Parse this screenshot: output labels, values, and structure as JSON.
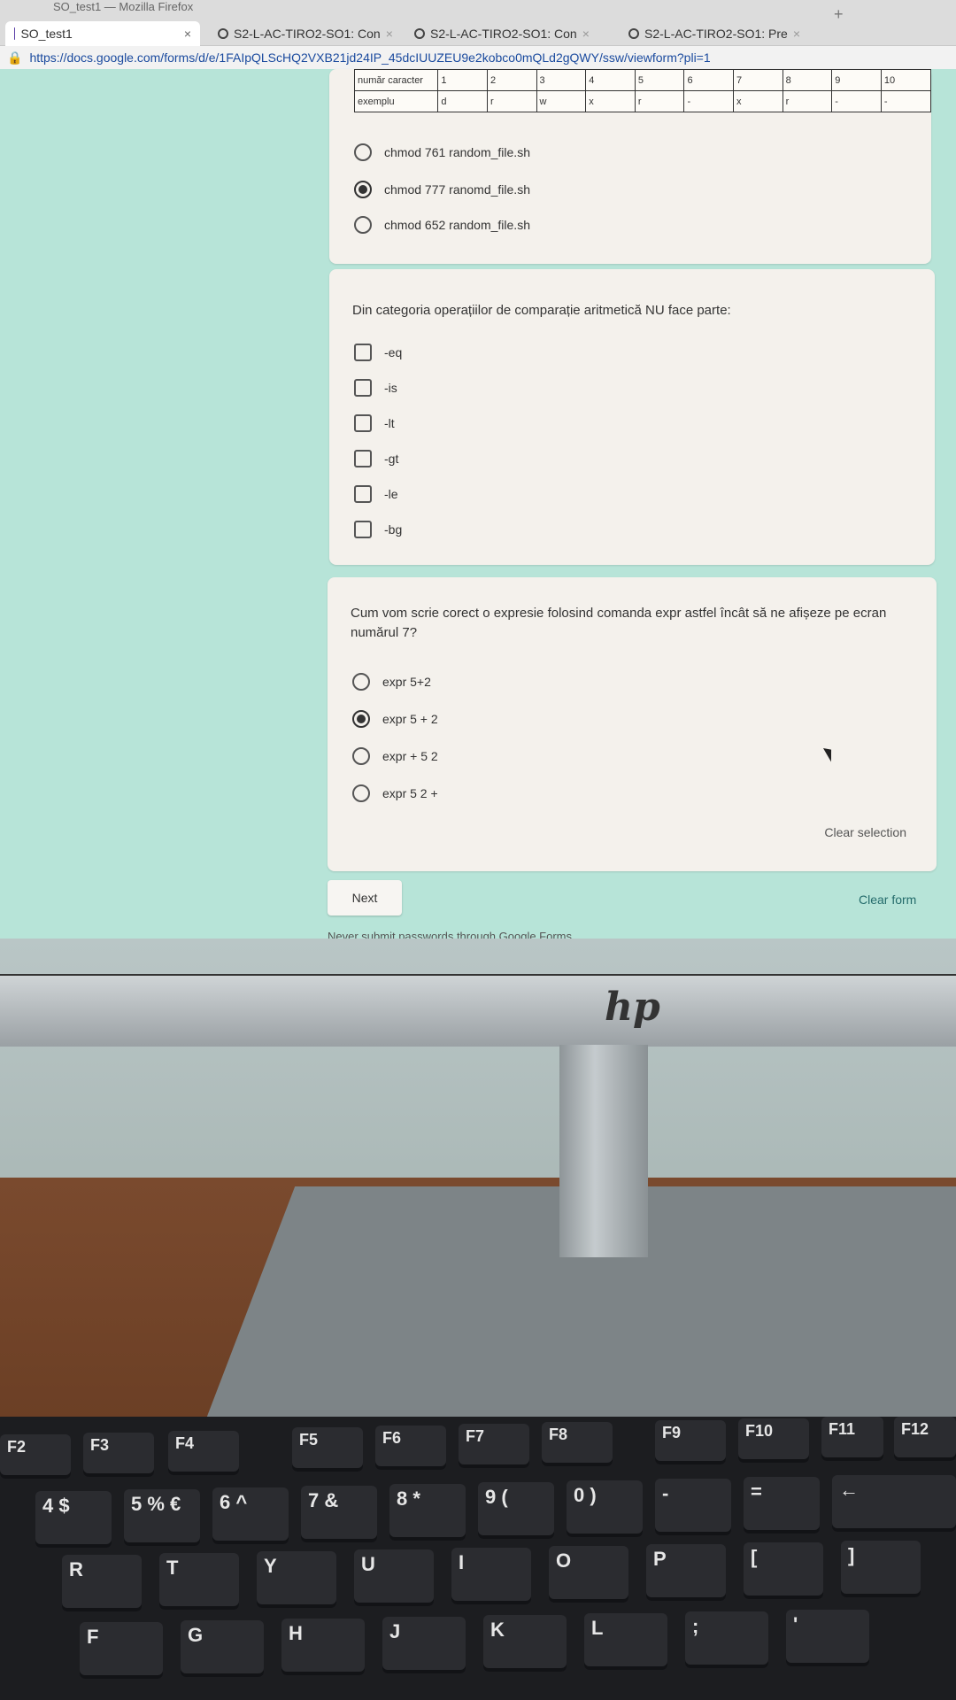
{
  "browser": {
    "window_title": "SO_test1 — Mozilla Firefox",
    "tabs": [
      {
        "label": "SO_test1",
        "active": true
      },
      {
        "label": "S2-L-AC-TIRO2-SO1: Con",
        "active": false
      },
      {
        "label": "S2-L-AC-TIRO2-SO1: Con",
        "active": false
      },
      {
        "label": "S2-L-AC-TIRO2-SO1: Pre",
        "active": false
      }
    ],
    "url": "https://docs.google.com/forms/d/e/1FAIpQLScHQ2VXB21jd24IP_45dcIUUZEU9e2kobco0mQLd2gQWY/ssw/viewform?pli=1"
  },
  "reference_table": {
    "row1": [
      "număr caracter",
      "1",
      "2",
      "3",
      "4",
      "5",
      "6",
      "7",
      "8",
      "9",
      "10"
    ],
    "row2": [
      "exemplu",
      "d",
      "r",
      "w",
      "x",
      "r",
      "-",
      "x",
      "r",
      "-",
      "-"
    ]
  },
  "q1": {
    "options": [
      {
        "label": "chmod 761 random_file.sh",
        "checked": false
      },
      {
        "label": "chmod 777 ranomd_file.sh",
        "checked": true
      },
      {
        "label": "chmod 652 random_file.sh",
        "checked": false
      }
    ]
  },
  "q2": {
    "text": "Din categoria operațiilor de comparație aritmetică NU face parte:",
    "options": [
      {
        "label": "-eq",
        "checked": false
      },
      {
        "label": "-is",
        "checked": false
      },
      {
        "label": "-lt",
        "checked": false
      },
      {
        "label": "-gt",
        "checked": false
      },
      {
        "label": "-le",
        "checked": false
      },
      {
        "label": "-bg",
        "checked": false
      }
    ]
  },
  "q3": {
    "text": "Cum vom scrie corect o expresie folosind comanda expr astfel încât să ne afișeze pe ecran numărul 7?",
    "options": [
      {
        "label": "expr 5+2",
        "checked": false
      },
      {
        "label": "expr 5 + 2",
        "checked": true
      },
      {
        "label": "expr + 5 2",
        "checked": false
      },
      {
        "label": "expr 5 2 +",
        "checked": false
      }
    ],
    "clear_selection": "Clear selection"
  },
  "form": {
    "next_label": "Next",
    "clear_form_label": "Clear form",
    "footer_note": "Never submit passwords through Google Forms."
  },
  "monitor": {
    "brand_logo": "hp"
  },
  "keyboard": {
    "fn_keys": [
      "F2",
      "F3",
      "F4",
      "F5",
      "F6",
      "F7",
      "F8",
      "F9",
      "F10",
      "F11",
      "F12"
    ],
    "number_keys": [
      "4 $",
      "5 % €",
      "6 ^",
      "7 &",
      "8 *",
      "9 (",
      "0 )",
      "-",
      "=",
      "←"
    ],
    "letter_row_1": [
      "R",
      "T",
      "Y",
      "U",
      "I",
      "O",
      "P",
      "[",
      "]"
    ],
    "letter_row_2": [
      "F",
      "G",
      "H",
      "J",
      "K",
      "L",
      ";",
      "'"
    ]
  },
  "colors": {
    "form_background": "#b7e4d8",
    "card_background": "#f4f1ec",
    "accent": "#246b6b"
  }
}
